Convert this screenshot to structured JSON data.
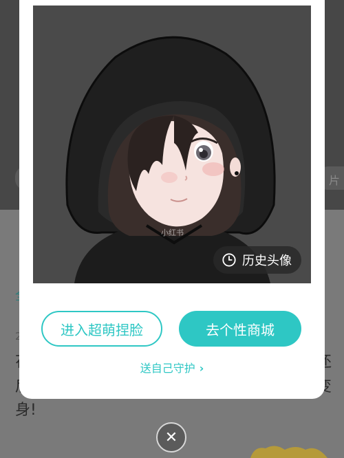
{
  "background": {
    "right_pill_text": "片",
    "green_text": "全",
    "date_text": "2",
    "line1_left": "花",
    "line1_right": "还",
    "line2_left": "后",
    "line2_right": "变",
    "line3": "身!"
  },
  "modal": {
    "watermark": "小红书",
    "history_button": {
      "label": "历史头像",
      "icon": "clock-icon"
    },
    "primary_actions": {
      "enter_face_label": "进入超萌捏脸",
      "shop_label": "去个性商城"
    },
    "guard_link": {
      "label": "送自己守护",
      "icon": "chevron-right-icon"
    }
  },
  "close_button": {
    "icon": "close-icon",
    "glyph": "✕"
  },
  "colors": {
    "accent": "#2ec7c4",
    "avatar_bg": "#4a4a4a",
    "hood": "#1f1f1f"
  }
}
